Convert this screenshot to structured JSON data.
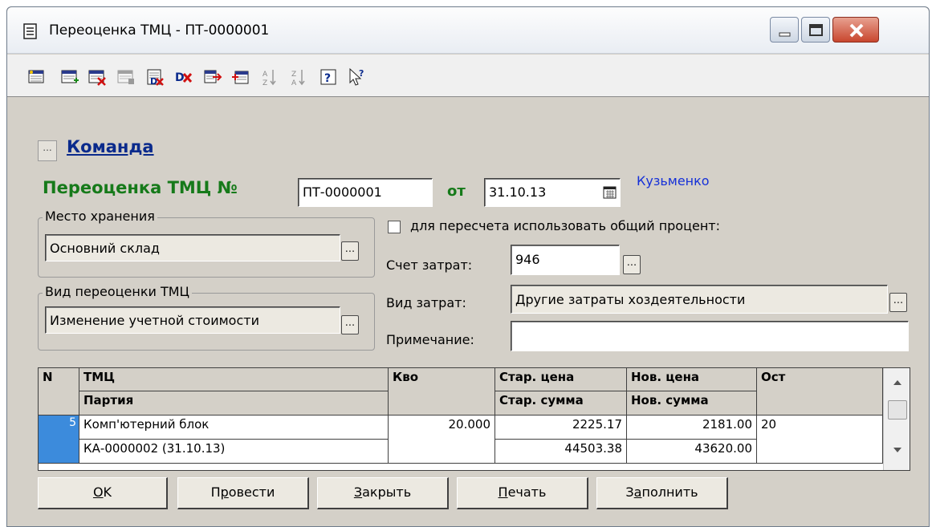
{
  "window": {
    "title": "Переоценка ТМЦ - ПТ-0000001"
  },
  "toolbar": {
    "icons": [
      "new-row-icon",
      "copy-row-icon",
      "delete-row-icon",
      "edit-row-icon",
      "delete-mark-icon",
      "delete-icon",
      "move-row-icon",
      "insert-row-icon",
      "sort-asc-icon",
      "sort-desc-icon",
      "help-icon",
      "context-help-icon"
    ]
  },
  "command": {
    "button": "...",
    "link": "Команда"
  },
  "header": {
    "doc_type": "Переоценка ТМЦ №",
    "number": "ПТ-0000001",
    "date_label": "от",
    "date": "31.10.13",
    "author": "Кузьменко"
  },
  "storage": {
    "group_label": "Место хранения",
    "value": "Основний склад"
  },
  "revaluation_type": {
    "group_label": "Вид переоценки ТМЦ",
    "value": "Изменение учетной стоимости"
  },
  "options": {
    "use_percent_label": "для пересчета использовать общий процент:",
    "use_percent_checked": false
  },
  "cost_account": {
    "label": "Счет затрат:",
    "value": "946"
  },
  "cost_type": {
    "label": "Вид затрат:",
    "value": "Другие затраты хоздеятельности"
  },
  "note": {
    "label": "Примечание:",
    "value": ""
  },
  "grid": {
    "headers": {
      "n": "N",
      "item": "ТМЦ",
      "batch": "Партия",
      "qty": "Кво",
      "old_price": "Стар. цена",
      "old_sum": "Стар. сумма",
      "new_price": "Нов. цена",
      "new_sum": "Нов. сумма",
      "rest": "Ост"
    },
    "rows": [
      {
        "n": "5",
        "item": "Комп'ютерний блок",
        "batch": "КА-0000002 (31.10.13)",
        "qty": "20.000",
        "old_price": "2225.17",
        "old_sum": "44503.38",
        "new_price": "2181.00",
        "new_sum": "43620.00",
        "rest": "20"
      }
    ]
  },
  "buttons": {
    "ok": {
      "key": "O",
      "rest": "K"
    },
    "post": {
      "pre": "П",
      "key": "р",
      "rest": "овести"
    },
    "close": {
      "key": "З",
      "rest": "акрыть"
    },
    "print": {
      "key": "П",
      "rest": "ечать"
    },
    "fill": {
      "pre": "З",
      "key": "а",
      "rest": "полнить"
    }
  }
}
